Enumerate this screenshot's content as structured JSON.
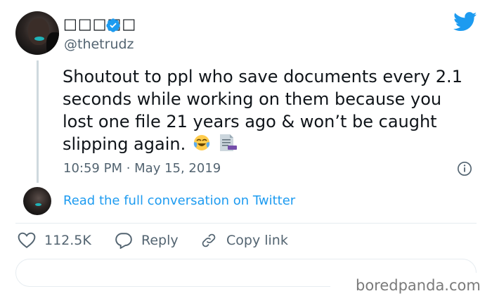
{
  "user": {
    "display_name": "□□□□□",
    "handle": "@thetrudz"
  },
  "tweet": {
    "text": "Shoutout to ppl who save documents every 2.1 seconds while working on them because you lost one file 21 years ago & won’t be caught slipping again.",
    "emojis": [
      "face-with-tears-of-joy-icon",
      "document-icon"
    ],
    "timestamp": "10:59 PM · May 15, 2019"
  },
  "conversation": {
    "link_text": "Read the full conversation on Twitter"
  },
  "actions": {
    "like_count": "112.5K",
    "reply_label": "Reply",
    "copy_label": "Copy link"
  },
  "watermark": "boredpanda.com",
  "colors": {
    "twitter_blue": "#1d9bf0",
    "muted_text": "#536471",
    "verified_blue": "#1d9bf0"
  }
}
